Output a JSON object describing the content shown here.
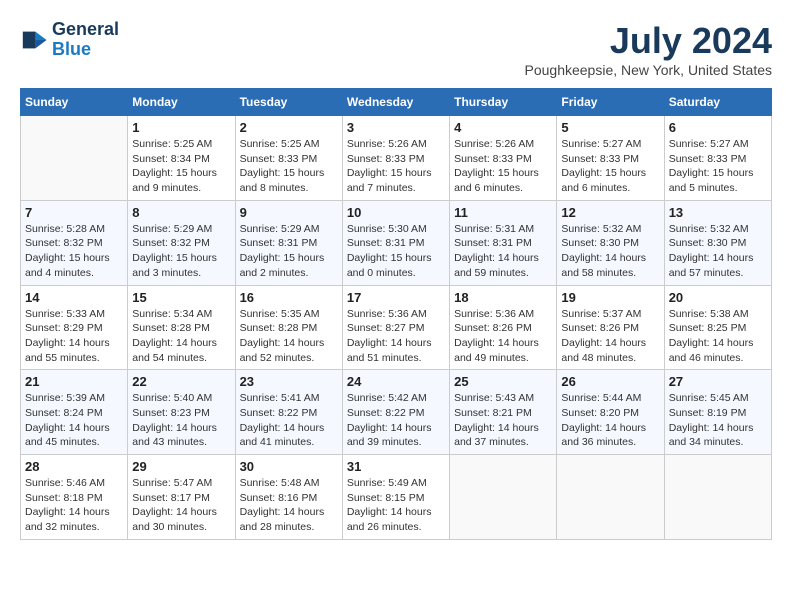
{
  "header": {
    "logo_general": "General",
    "logo_blue": "Blue",
    "month_title": "July 2024",
    "subtitle": "Poughkeepsie, New York, United States"
  },
  "days_of_week": [
    "Sunday",
    "Monday",
    "Tuesday",
    "Wednesday",
    "Thursday",
    "Friday",
    "Saturday"
  ],
  "weeks": [
    [
      {
        "day": "",
        "info": ""
      },
      {
        "day": "1",
        "info": "Sunrise: 5:25 AM\nSunset: 8:34 PM\nDaylight: 15 hours\nand 9 minutes."
      },
      {
        "day": "2",
        "info": "Sunrise: 5:25 AM\nSunset: 8:33 PM\nDaylight: 15 hours\nand 8 minutes."
      },
      {
        "day": "3",
        "info": "Sunrise: 5:26 AM\nSunset: 8:33 PM\nDaylight: 15 hours\nand 7 minutes."
      },
      {
        "day": "4",
        "info": "Sunrise: 5:26 AM\nSunset: 8:33 PM\nDaylight: 15 hours\nand 6 minutes."
      },
      {
        "day": "5",
        "info": "Sunrise: 5:27 AM\nSunset: 8:33 PM\nDaylight: 15 hours\nand 6 minutes."
      },
      {
        "day": "6",
        "info": "Sunrise: 5:27 AM\nSunset: 8:33 PM\nDaylight: 15 hours\nand 5 minutes."
      }
    ],
    [
      {
        "day": "7",
        "info": "Sunrise: 5:28 AM\nSunset: 8:32 PM\nDaylight: 15 hours\nand 4 minutes."
      },
      {
        "day": "8",
        "info": "Sunrise: 5:29 AM\nSunset: 8:32 PM\nDaylight: 15 hours\nand 3 minutes."
      },
      {
        "day": "9",
        "info": "Sunrise: 5:29 AM\nSunset: 8:31 PM\nDaylight: 15 hours\nand 2 minutes."
      },
      {
        "day": "10",
        "info": "Sunrise: 5:30 AM\nSunset: 8:31 PM\nDaylight: 15 hours\nand 0 minutes."
      },
      {
        "day": "11",
        "info": "Sunrise: 5:31 AM\nSunset: 8:31 PM\nDaylight: 14 hours\nand 59 minutes."
      },
      {
        "day": "12",
        "info": "Sunrise: 5:32 AM\nSunset: 8:30 PM\nDaylight: 14 hours\nand 58 minutes."
      },
      {
        "day": "13",
        "info": "Sunrise: 5:32 AM\nSunset: 8:30 PM\nDaylight: 14 hours\nand 57 minutes."
      }
    ],
    [
      {
        "day": "14",
        "info": "Sunrise: 5:33 AM\nSunset: 8:29 PM\nDaylight: 14 hours\nand 55 minutes."
      },
      {
        "day": "15",
        "info": "Sunrise: 5:34 AM\nSunset: 8:28 PM\nDaylight: 14 hours\nand 54 minutes."
      },
      {
        "day": "16",
        "info": "Sunrise: 5:35 AM\nSunset: 8:28 PM\nDaylight: 14 hours\nand 52 minutes."
      },
      {
        "day": "17",
        "info": "Sunrise: 5:36 AM\nSunset: 8:27 PM\nDaylight: 14 hours\nand 51 minutes."
      },
      {
        "day": "18",
        "info": "Sunrise: 5:36 AM\nSunset: 8:26 PM\nDaylight: 14 hours\nand 49 minutes."
      },
      {
        "day": "19",
        "info": "Sunrise: 5:37 AM\nSunset: 8:26 PM\nDaylight: 14 hours\nand 48 minutes."
      },
      {
        "day": "20",
        "info": "Sunrise: 5:38 AM\nSunset: 8:25 PM\nDaylight: 14 hours\nand 46 minutes."
      }
    ],
    [
      {
        "day": "21",
        "info": "Sunrise: 5:39 AM\nSunset: 8:24 PM\nDaylight: 14 hours\nand 45 minutes."
      },
      {
        "day": "22",
        "info": "Sunrise: 5:40 AM\nSunset: 8:23 PM\nDaylight: 14 hours\nand 43 minutes."
      },
      {
        "day": "23",
        "info": "Sunrise: 5:41 AM\nSunset: 8:22 PM\nDaylight: 14 hours\nand 41 minutes."
      },
      {
        "day": "24",
        "info": "Sunrise: 5:42 AM\nSunset: 8:22 PM\nDaylight: 14 hours\nand 39 minutes."
      },
      {
        "day": "25",
        "info": "Sunrise: 5:43 AM\nSunset: 8:21 PM\nDaylight: 14 hours\nand 37 minutes."
      },
      {
        "day": "26",
        "info": "Sunrise: 5:44 AM\nSunset: 8:20 PM\nDaylight: 14 hours\nand 36 minutes."
      },
      {
        "day": "27",
        "info": "Sunrise: 5:45 AM\nSunset: 8:19 PM\nDaylight: 14 hours\nand 34 minutes."
      }
    ],
    [
      {
        "day": "28",
        "info": "Sunrise: 5:46 AM\nSunset: 8:18 PM\nDaylight: 14 hours\nand 32 minutes."
      },
      {
        "day": "29",
        "info": "Sunrise: 5:47 AM\nSunset: 8:17 PM\nDaylight: 14 hours\nand 30 minutes."
      },
      {
        "day": "30",
        "info": "Sunrise: 5:48 AM\nSunset: 8:16 PM\nDaylight: 14 hours\nand 28 minutes."
      },
      {
        "day": "31",
        "info": "Sunrise: 5:49 AM\nSunset: 8:15 PM\nDaylight: 14 hours\nand 26 minutes."
      },
      {
        "day": "",
        "info": ""
      },
      {
        "day": "",
        "info": ""
      },
      {
        "day": "",
        "info": ""
      }
    ]
  ]
}
